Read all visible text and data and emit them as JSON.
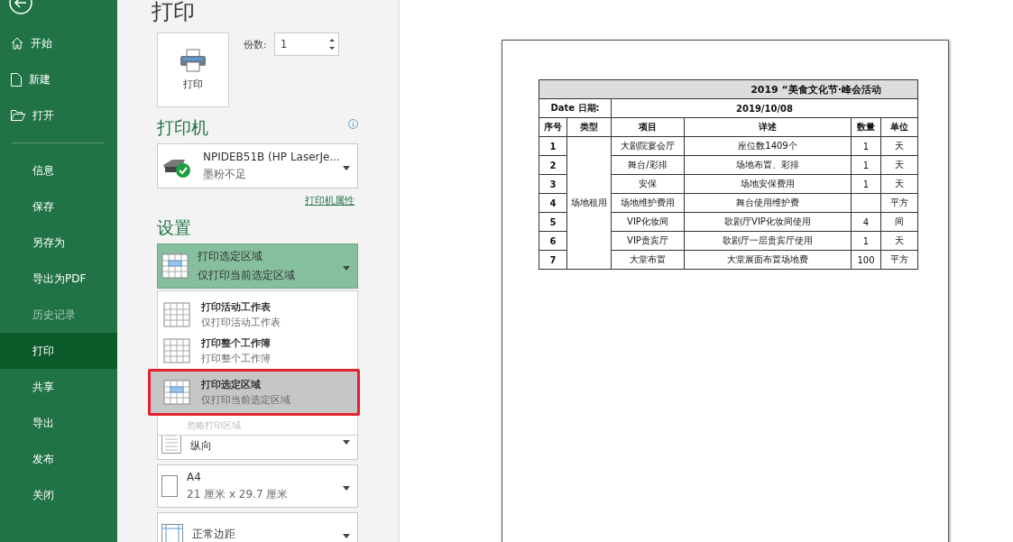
{
  "sidebar": {
    "items": [
      {
        "label": "开始",
        "kind": "home",
        "selected": false,
        "disabled": false
      },
      {
        "label": "新建",
        "kind": "file",
        "selected": false,
        "disabled": false
      },
      {
        "label": "打开",
        "kind": "folder",
        "selected": false,
        "disabled": false
      },
      {
        "label": "信息",
        "kind": "plain",
        "selected": false,
        "disabled": false
      },
      {
        "label": "保存",
        "kind": "plain",
        "selected": false,
        "disabled": false
      },
      {
        "label": "另存为",
        "kind": "plain",
        "selected": false,
        "disabled": false
      },
      {
        "label": "导出为PDF",
        "kind": "plain",
        "selected": false,
        "disabled": false
      },
      {
        "label": "历史记录",
        "kind": "plain",
        "selected": false,
        "disabled": true
      },
      {
        "label": "打印",
        "kind": "plain",
        "selected": true,
        "disabled": false
      },
      {
        "label": "共享",
        "kind": "plain",
        "selected": false,
        "disabled": false
      },
      {
        "label": "导出",
        "kind": "plain",
        "selected": false,
        "disabled": false
      },
      {
        "label": "发布",
        "kind": "plain",
        "selected": false,
        "disabled": false
      },
      {
        "label": "关闭",
        "kind": "plain",
        "selected": false,
        "disabled": false
      }
    ]
  },
  "page_title": "打印",
  "print_button": {
    "label": "打印"
  },
  "copies": {
    "label": "份数:",
    "value": "1"
  },
  "printer": {
    "heading": "打印机",
    "name": "NPIDEB51B (HP LaserJe...",
    "status": "墨粉不足",
    "properties_link": "打印机属性"
  },
  "settings": {
    "heading": "设置",
    "current": {
      "title": "打印选定区域",
      "subtitle": "仅打印当前选定区域"
    },
    "menu": {
      "items": [
        {
          "title": "打印活动工作表",
          "subtitle": "仅打印活动工作表",
          "selected": false
        },
        {
          "title": "打印整个工作簿",
          "subtitle": "打印整个工作簿",
          "selected": false
        },
        {
          "title": "打印选定区域",
          "subtitle": "仅打印当前选定区域",
          "selected": true
        }
      ],
      "ignore_print_area": {
        "label": "忽略打印区域",
        "disabled": true
      }
    },
    "options": [
      {
        "kind": "orientation",
        "title": "纵向"
      },
      {
        "kind": "paper",
        "title": "A4",
        "subtitle": "21 厘米 x 29.7 厘米"
      },
      {
        "kind": "margins",
        "title": "正常边距"
      }
    ]
  },
  "preview": {
    "table": {
      "title": "2019 “美食文化节·峰会活动",
      "date_label": "Date 日期:",
      "date": "2019/10/08",
      "columns": [
        "序号",
        "类型",
        "项目",
        "详述",
        "数量",
        "单位"
      ],
      "type": "场地租用",
      "rows": [
        {
          "no": "1",
          "item": "大剧院宴会厅",
          "detail": "座位数1409个",
          "qty": "1",
          "unit": "天"
        },
        {
          "no": "2",
          "item": "舞台/彩排",
          "detail": "场地布置、彩排",
          "qty": "1",
          "unit": "天"
        },
        {
          "no": "3",
          "item": "安保",
          "detail": "场地安保费用",
          "qty": "1",
          "unit": "天"
        },
        {
          "no": "4",
          "item": "场地维护费用",
          "detail": "舞台使用维护费",
          "unit": "平方"
        },
        {
          "no": "5",
          "item": "VIP化妆间",
          "detail": "歌剧厅VIP化妆间使用",
          "qty": "4",
          "unit": "间"
        },
        {
          "no": "6",
          "item": "VIP贵宾厅",
          "detail": "歌剧厅一层贵宾厅使用",
          "qty": "1",
          "unit": "天"
        },
        {
          "no": "7",
          "item": "大堂布置",
          "detail": "大堂展面布置场地费",
          "qty": "100",
          "unit": "平方"
        }
      ]
    }
  }
}
